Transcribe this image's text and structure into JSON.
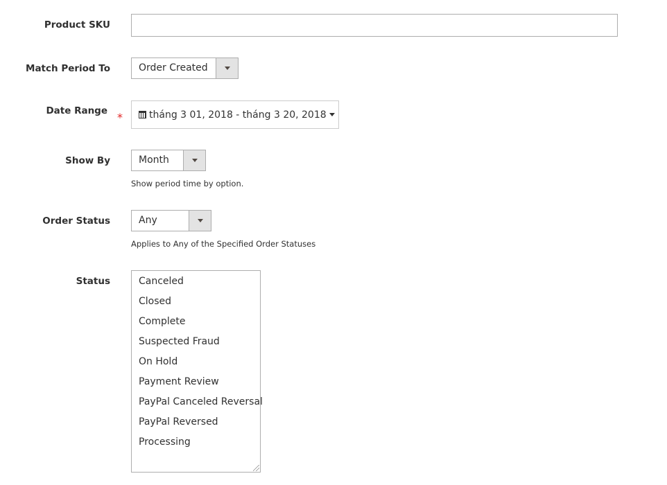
{
  "form": {
    "product_sku": {
      "label": "Product SKU",
      "value": ""
    },
    "match_period_to": {
      "label": "Match Period To",
      "value": "Order Created"
    },
    "date_range": {
      "label": "Date Range",
      "required_mark": "*",
      "value": "tháng 3 01, 2018 - tháng 3 20, 2018"
    },
    "show_by": {
      "label": "Show By",
      "value": "Month",
      "note": "Show period time by option."
    },
    "order_status": {
      "label": "Order Status",
      "value": "Any",
      "note": "Applies to Any of the Specified Order Statuses"
    },
    "status": {
      "label": "Status",
      "options": [
        "Canceled",
        "Closed",
        "Complete",
        "Suspected Fraud",
        "On Hold",
        "Payment Review",
        "PayPal Canceled Reversal",
        "PayPal Reversed",
        "Processing"
      ]
    }
  }
}
